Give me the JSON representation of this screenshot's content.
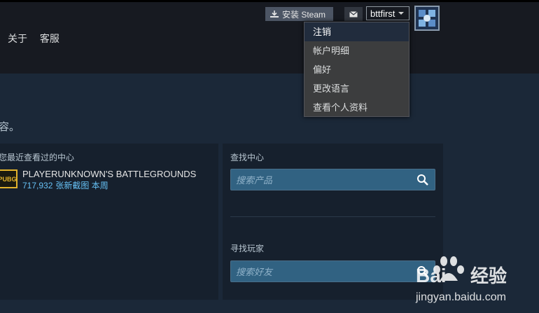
{
  "header": {
    "nav": [
      "关于",
      "客服"
    ],
    "install_label": "安装 Steam",
    "username": "bttfirst"
  },
  "account_menu": [
    "注销",
    "帐户明细",
    "偏好",
    "更改语言",
    "查看个人资料"
  ],
  "main": {
    "partial_text": "容。",
    "recent": {
      "title": "您最近查看过的中心",
      "game_name": "PLAYERUNKNOWN'S BATTLEGROUNDS",
      "game_logo_text": "PUBG",
      "count": "717,932",
      "stats_text": "张新截图 本周"
    },
    "find_hub": {
      "title": "查找中心",
      "placeholder": "搜索产品"
    },
    "find_players": {
      "title": "寻找玩家",
      "placeholder": "搜索好友"
    }
  },
  "watermark": {
    "brand": "Baidu经验",
    "url": "jingyan.baidu.com"
  }
}
